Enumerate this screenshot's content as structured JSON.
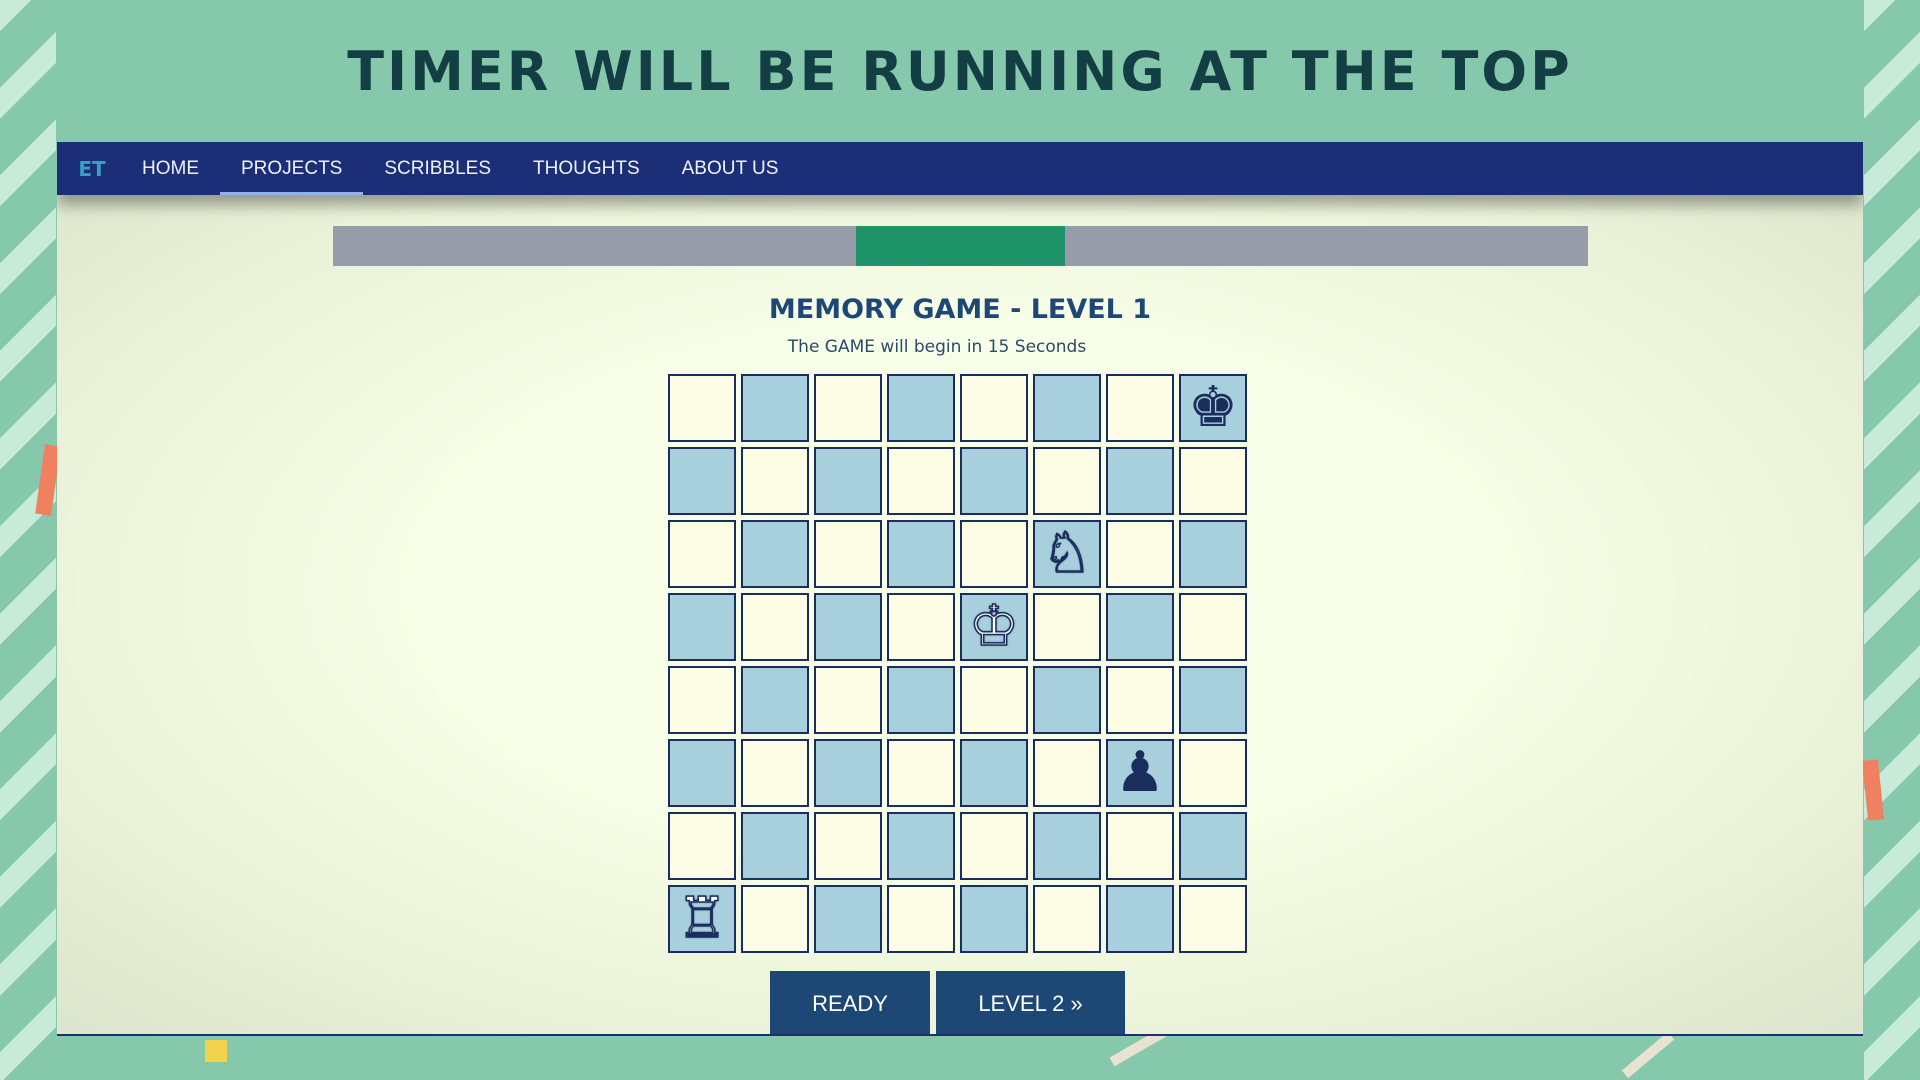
{
  "headline": "TIMER WILL BE RUNNING AT THE TOP",
  "nav": {
    "brand": "ET",
    "items": [
      {
        "label": "HOME",
        "active": false
      },
      {
        "label": "PROJECTS",
        "active": true
      },
      {
        "label": "SCRIBBLES",
        "active": false
      },
      {
        "label": "THOUGHTS",
        "active": false
      },
      {
        "label": "ABOUT US",
        "active": false
      }
    ]
  },
  "timer": {
    "fill_start_fraction": 0.4167,
    "fill_end_fraction": 0.5833,
    "track_color": "#969ca8",
    "fill_color": "#1f9469"
  },
  "game": {
    "title": "MEMORY GAME - LEVEL 1",
    "subtitle": "The GAME will begin in 15 Seconds",
    "board": {
      "size": 8,
      "light_color": "#fdfde6",
      "dark_color": "#a8cfdc",
      "pieces": [
        {
          "row": 0,
          "col": 7,
          "glyph": "♚",
          "name": "black-king-icon",
          "color": "black"
        },
        {
          "row": 2,
          "col": 5,
          "glyph": "♘",
          "name": "white-knight-icon",
          "color": "white"
        },
        {
          "row": 3,
          "col": 4,
          "glyph": "♔",
          "name": "white-king-icon",
          "color": "white"
        },
        {
          "row": 5,
          "col": 6,
          "glyph": "♟",
          "name": "black-pawn-icon",
          "color": "black"
        },
        {
          "row": 7,
          "col": 0,
          "glyph": "♖",
          "name": "white-rook-icon",
          "color": "white"
        }
      ]
    }
  },
  "buttons": {
    "ready": "READY",
    "next_level": "LEVEL 2 »"
  }
}
